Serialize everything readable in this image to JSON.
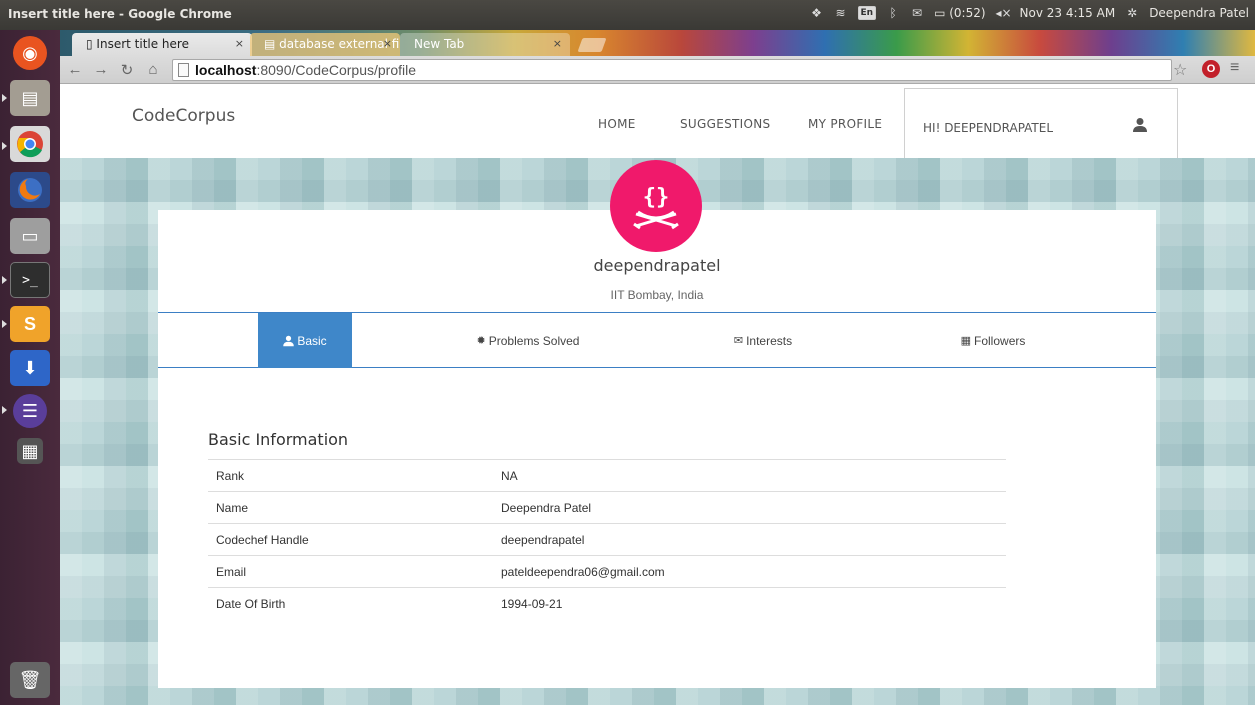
{
  "system": {
    "window_title": "Insert title here - Google Chrome",
    "keyboard_layout": "En",
    "battery": "(0:52)",
    "datetime": "Nov 23  4:15 AM",
    "user": "Deependra Patel"
  },
  "browser": {
    "tabs": [
      {
        "title": "Insert title here",
        "active": true
      },
      {
        "title": "database external fi",
        "active": false
      },
      {
        "title": "New Tab",
        "active": false
      }
    ],
    "url_host": "localhost",
    "url_rest": ":8090/CodeCorpus/profile"
  },
  "site": {
    "brand": "CodeCorpus",
    "nav": {
      "home": "HOME",
      "suggestions": "SUGGESTIONS",
      "profile": "MY PROFILE"
    },
    "greeting": "HI! DEEPENDRAPATEL"
  },
  "profile": {
    "avatar_glyph": "{}",
    "username": "deependrapatel",
    "location": "IIT Bombay, India",
    "tabs": {
      "basic": "Basic",
      "problems": "Problems Solved",
      "interests": "Interests",
      "followers": "Followers"
    },
    "section_title": "Basic Information",
    "rows": [
      {
        "key": "Rank",
        "value": "NA"
      },
      {
        "key": "Name",
        "value": "Deependra Patel"
      },
      {
        "key": "Codechef Handle",
        "value": "deependrapatel"
      },
      {
        "key": "Email",
        "value": "pateldeependra06@gmail.com"
      },
      {
        "key": "Date Of Birth",
        "value": "1994-09-21"
      }
    ]
  },
  "colors": {
    "accent": "#3f87c9",
    "avatar": "#f0196b"
  }
}
